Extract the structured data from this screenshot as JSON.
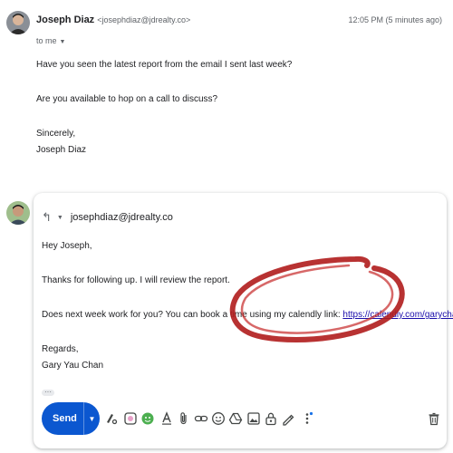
{
  "received": {
    "sender_name": "Joseph Diaz",
    "sender_email": "<josephdiaz@jdrealty.co>",
    "timestamp": "12:05 PM (5 minutes ago)",
    "to_label": "to me",
    "body": [
      "Have you seen the latest report from the email I sent last week?",
      "Are you available to hop on a call to discuss?",
      "Sincerely,",
      "Joseph Diaz"
    ]
  },
  "reply": {
    "to_address": "josephdiaz@jdrealty.co",
    "greeting": "Hey Joseph,",
    "line1": "Thanks for following up. I will review the report.",
    "line2_prefix": "Does next week work for you? You can book a time using my calendly link: ",
    "link": "https://calendly.com/garychan",
    "closing": "Regards,",
    "signature": "Gary Yau Chan"
  },
  "toolbar": {
    "send_label": "Send",
    "icons": [
      "format-options-icon",
      "color-palette-icon",
      "emoji-avatar-icon",
      "text-format-icon",
      "attach-file-icon",
      "insert-link-icon",
      "insert-emoji-icon",
      "google-drive-icon",
      "insert-photo-icon",
      "confidential-mode-icon",
      "signature-icon",
      "more-options-icon",
      "discard-draft-icon"
    ]
  },
  "colors": {
    "send_button": "#0b57d0",
    "link": "#1a0dab",
    "annotation": "#b01c1c"
  }
}
